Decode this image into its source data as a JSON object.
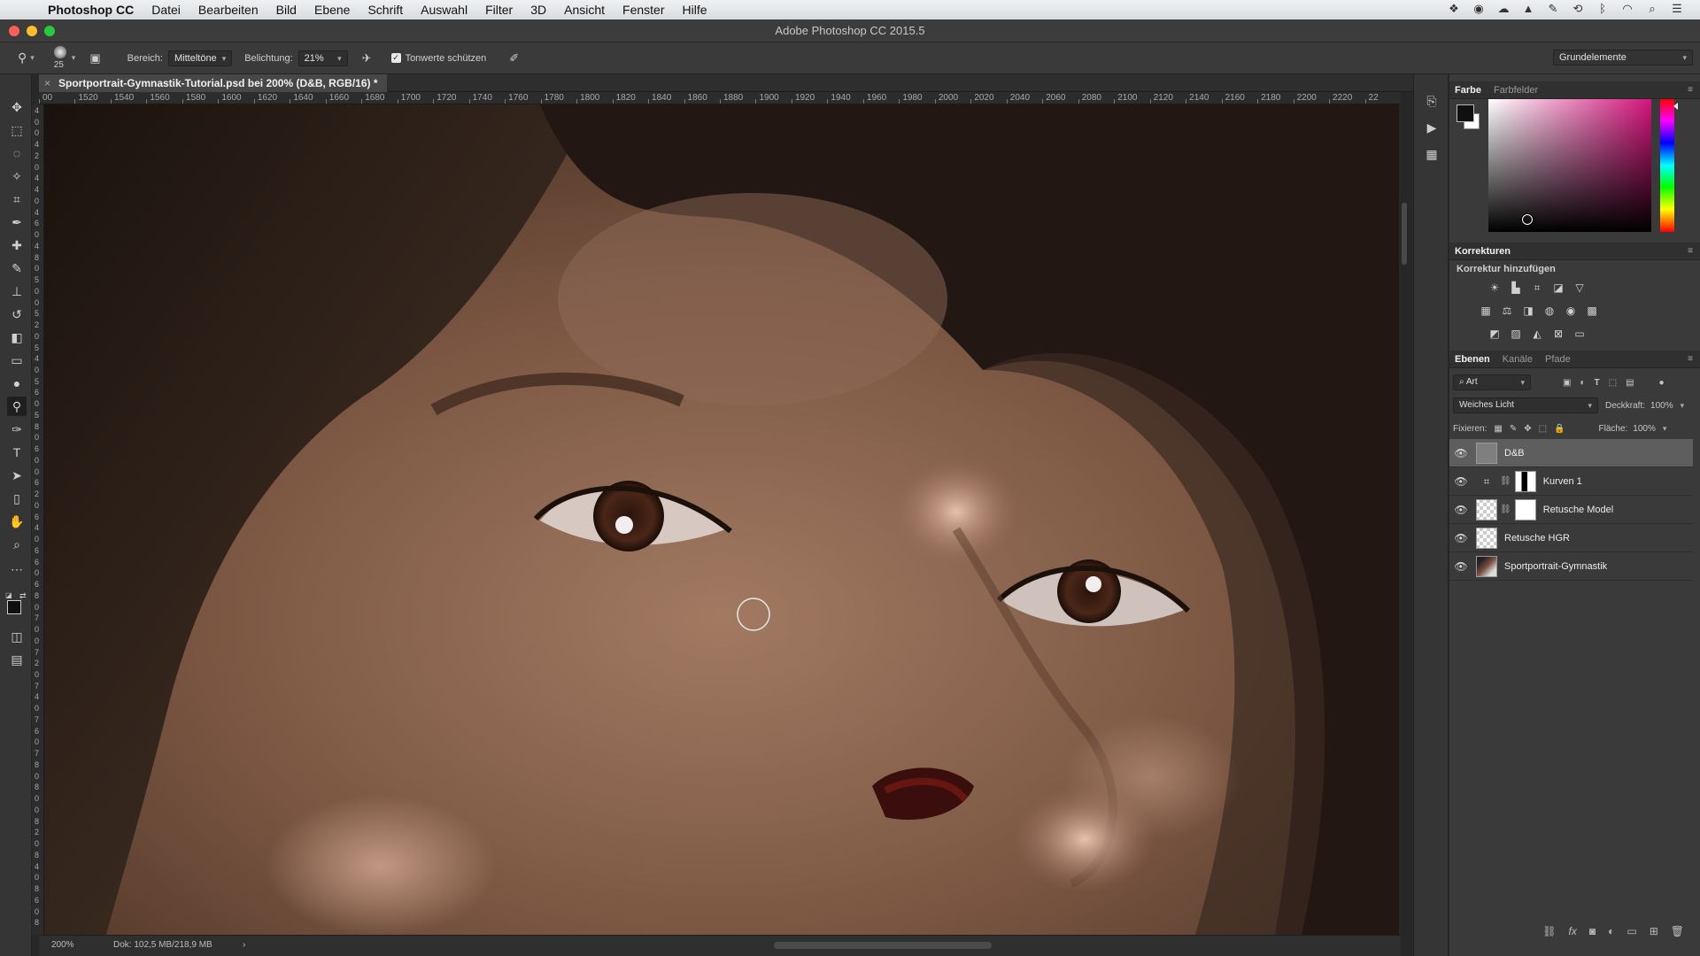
{
  "menubar": {
    "app": "Photoshop CC",
    "items": [
      "Datei",
      "Bearbeiten",
      "Bild",
      "Ebene",
      "Schrift",
      "Auswahl",
      "Filter",
      "3D",
      "Ansicht",
      "Fenster",
      "Hilfe"
    ]
  },
  "window": {
    "title": "Adobe Photoshop CC 2015.5"
  },
  "options": {
    "brush_size": "25",
    "bereich_label": "Bereich:",
    "bereich_value": "Mitteltöne",
    "belichtung_label": "Belichtung:",
    "belichtung_value": "21%",
    "protect_tones_label": "Tonwerte schützen",
    "protect_tones_checked": true,
    "workspace": "Grundelemente"
  },
  "document": {
    "tab_title": "Sportportrait-Gymnastik-Tutorial.psd bei 200% (D&B, RGB/16) *",
    "ruler_ticks": [
      "00",
      "1520",
      "1540",
      "1560",
      "1580",
      "1600",
      "1620",
      "1640",
      "1660",
      "1680",
      "1700",
      "1720",
      "1740",
      "1760",
      "1780",
      "1800",
      "1820",
      "1840",
      "1860",
      "1880",
      "1900",
      "1920",
      "1940",
      "1960",
      "1980",
      "2000",
      "2020",
      "2040",
      "2060",
      "2080",
      "2100",
      "2120",
      "2140",
      "2160",
      "2180",
      "2200",
      "2220",
      "22"
    ],
    "vruler_ticks": [
      "4",
      "0",
      "0",
      "4",
      "2",
      "0",
      "4",
      "4",
      "0",
      "4",
      "6",
      "0",
      "4",
      "8",
      "0",
      "5",
      "0",
      "0",
      "5",
      "2",
      "0",
      "5",
      "4",
      "0",
      "5",
      "6",
      "0",
      "5",
      "8",
      "0",
      "6",
      "0",
      "0",
      "6",
      "2",
      "0",
      "6",
      "4",
      "0",
      "6",
      "6",
      "0",
      "6",
      "8",
      "0",
      "7",
      "0",
      "0",
      "7",
      "2",
      "0",
      "7",
      "4",
      "0",
      "7",
      "6",
      "0",
      "7",
      "8",
      "0",
      "8",
      "0",
      "0",
      "8",
      "2",
      "0",
      "8",
      "4",
      "0",
      "8",
      "6",
      "0",
      "8"
    ]
  },
  "status": {
    "zoom": "200%",
    "doc": "Dok: 102,5 MB/218,9 MB",
    "arrow": "›"
  },
  "color_panel": {
    "tabs": [
      "Farbe",
      "Farbfelder"
    ],
    "active_tab": "Farbe",
    "foreground": "#101010",
    "background": "#ffffff",
    "hue_color": "#d4147c"
  },
  "adjustments_panel": {
    "title": "Korrekturen",
    "subtitle": "Korrektur hinzufügen"
  },
  "layers_panel": {
    "tabs": [
      "Ebenen",
      "Kanäle",
      "Pfade"
    ],
    "active_tab": "Ebenen",
    "filter_kind": "Art",
    "blend_mode": "Weiches Licht",
    "opacity_label": "Deckkraft:",
    "opacity_value": "100%",
    "lock_label": "Fixieren:",
    "fill_label": "Fläche:",
    "fill_value": "100%",
    "layers": [
      {
        "name": "D&B",
        "selected": true,
        "visible": true,
        "type": "gray"
      },
      {
        "name": "Kurven 1",
        "selected": false,
        "visible": true,
        "type": "curves-mask"
      },
      {
        "name": "Retusche Model",
        "selected": false,
        "visible": true,
        "type": "transparent-mask"
      },
      {
        "name": "Retusche HGR",
        "selected": false,
        "visible": true,
        "type": "transparent"
      },
      {
        "name": "Sportportrait-Gymnastik",
        "selected": false,
        "visible": true,
        "type": "photo"
      }
    ]
  },
  "icons": {
    "apple": "apple-icon",
    "close": "×",
    "menu": "≡",
    "eye": "👁",
    "chain": "⛓"
  }
}
